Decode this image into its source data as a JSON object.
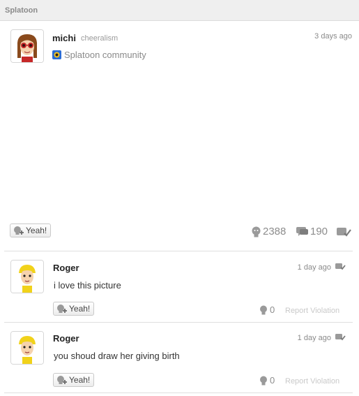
{
  "header": {
    "title": "Splatoon"
  },
  "post": {
    "username": "michi",
    "handle": "cheeralism",
    "community": "Splatoon community",
    "time": "3 days ago",
    "yeah_label": "Yeah!",
    "yeah_count": "2388",
    "comment_count": "190"
  },
  "comments": [
    {
      "username": "Roger",
      "time": "1 day ago",
      "text": "i love this picture",
      "yeah_label": "Yeah!",
      "yeah_count": "0",
      "report_label": "Report Violation"
    },
    {
      "username": "Roger",
      "time": "1 day ago",
      "text": "you shoud draw her giving birth",
      "yeah_label": "Yeah!",
      "yeah_count": "0",
      "report_label": "Report Violation"
    }
  ],
  "icons": {
    "yeah": "yeah-plus-icon",
    "yeah_count": "yeah-face-icon",
    "comments": "speech-bubble-icon",
    "spoiler": "spoiler-flag-icon",
    "community": "splatoon-community-icon"
  },
  "colors": {
    "text": "#333333",
    "muted": "#8a8a8a",
    "divider": "#dedede"
  }
}
